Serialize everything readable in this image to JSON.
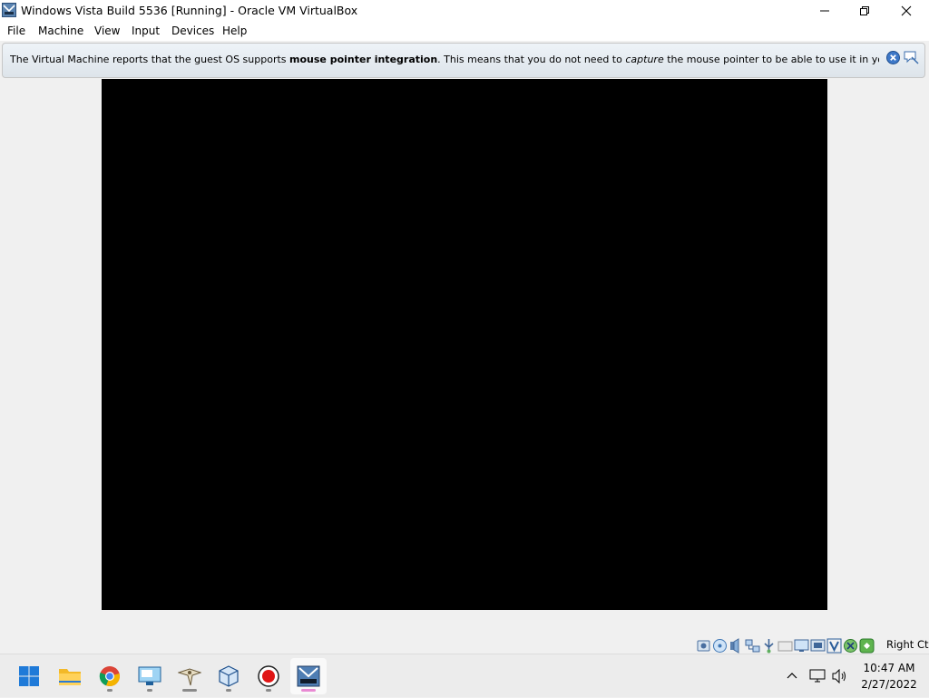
{
  "window": {
    "title": "Windows Vista Build 5536 [Running] - Oracle VM VirtualBox",
    "icons": [
      "virtualbox-vm-icon",
      "minimize-icon",
      "maximize-icon",
      "close-icon"
    ]
  },
  "menu": {
    "items": [
      {
        "label": "File"
      },
      {
        "label": "Machine"
      },
      {
        "label": "View"
      },
      {
        "label": "Input"
      },
      {
        "label": "Devices"
      },
      {
        "label": "Help"
      }
    ]
  },
  "notice": {
    "text_before": "The Virtual Machine reports that the guest OS supports ",
    "bold": "mouse pointer integration",
    "text_middle": ". This means that you do not need to ",
    "italic": "capture",
    "text_after": " the mouse pointer to be able to use it in your guest OS -- all mouse",
    "icons": [
      "close-notice-icon",
      "do-not-show-again-icon"
    ]
  },
  "vm": {
    "screen_color": "#000000"
  },
  "statusbar": {
    "icons": [
      "hard-disk-icon",
      "optical-drive-icon",
      "audio-icon",
      "network-icon",
      "usb-icon",
      "shared-folders-icon",
      "display-icon",
      "recording-icon",
      "vt-x-icon",
      "mouse-integration-icon",
      "keyboard-capture-icon"
    ],
    "host_key": "Right Ctrl"
  },
  "taskbar": {
    "apps": [
      {
        "name": "start-icon"
      },
      {
        "name": "file-explorer-icon"
      },
      {
        "name": "chrome-icon"
      },
      {
        "name": "remote-desktop-icon"
      },
      {
        "name": "eagle-app-icon"
      },
      {
        "name": "virtualbox-icon"
      },
      {
        "name": "record-icon"
      },
      {
        "name": "vista-vm-icon"
      }
    ],
    "tray_icons": [
      "chevron-up-icon",
      "network-icon",
      "volume-icon"
    ],
    "time": "10:47 AM",
    "date": "2/27/2022"
  }
}
